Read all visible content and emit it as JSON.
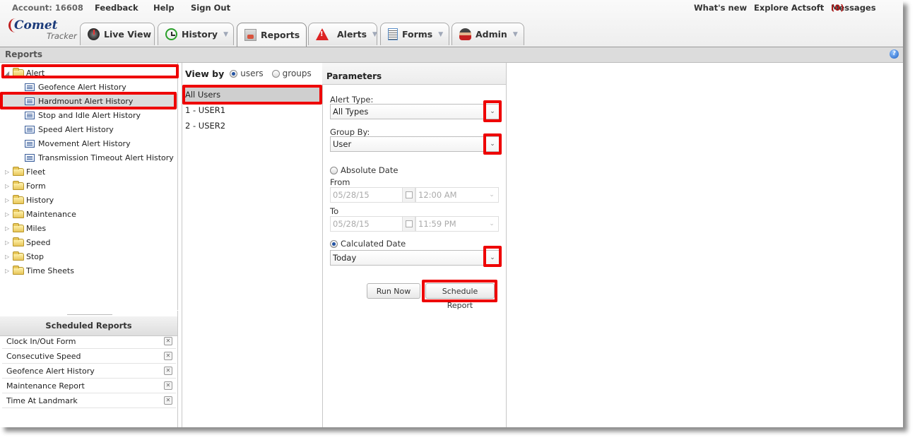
{
  "top_links": {
    "account": "Account: 16608",
    "feedback": "Feedback",
    "help": "Help",
    "sign_out": "Sign Out",
    "whats_new": "What's new",
    "explore": "Explore Actsoft",
    "messages": "Messages",
    "messages_count": "(0)"
  },
  "logo": {
    "name": "Comet",
    "sub": "Tracker"
  },
  "tabs": [
    {
      "label": "Live View",
      "icon": "live-view-icon",
      "has_dropdown": false
    },
    {
      "label": "History",
      "icon": "clock-icon",
      "has_dropdown": true
    },
    {
      "label": "Reports",
      "icon": "reports-icon",
      "has_dropdown": false,
      "active": true
    },
    {
      "label": "Alerts",
      "icon": "alert-triangle-icon",
      "has_dropdown": true
    },
    {
      "label": "Forms",
      "icon": "document-icon",
      "has_dropdown": true
    },
    {
      "label": "Admin",
      "icon": "admin-user-icon",
      "has_dropdown": true
    }
  ],
  "dropdown_glyph": "▼",
  "reports_header": {
    "title": "Reports",
    "help_glyph": "?"
  },
  "tree": {
    "alert_folder": "Alert",
    "alert_children": [
      "Geofence Alert History",
      "Hardmount Alert History",
      "Stop and Idle Alert History",
      "Speed Alert History",
      "Movement Alert History",
      "Transmission Timeout Alert History"
    ],
    "selected_child": "Hardmount Alert History",
    "folders": [
      "Fleet",
      "Form",
      "History",
      "Maintenance",
      "Miles",
      "Speed",
      "Stop",
      "Time Sheets"
    ],
    "expanded_glyph": "◢",
    "collapsed_glyph": "▷"
  },
  "scheduled": {
    "title": "Scheduled Reports",
    "items": [
      "Clock In/Out Form",
      "Consecutive Speed",
      "Geofence Alert History",
      "Maintenance Report",
      "Time At Landmark"
    ],
    "remove_glyph": "✕"
  },
  "users_panel": {
    "view_by_label": "View by",
    "option_users": "users",
    "option_groups": "groups",
    "selected_option": "users",
    "rows": [
      "All Users",
      "1 - USER1",
      "2 - USER2"
    ],
    "selected_row": "All Users"
  },
  "params": {
    "title": "Parameters",
    "alert_type_label": "Alert Type:",
    "alert_type_value": "All Types",
    "group_by_label": "Group By:",
    "group_by_value": "User",
    "absolute_date_label": "Absolute Date",
    "from_label": "From",
    "from_date": "05/28/15",
    "from_time": "12:00 AM",
    "to_label": "To",
    "to_date": "05/28/15",
    "to_time": "11:59 PM",
    "calculated_date_label": "Calculated Date",
    "calculated_date_value": "Today",
    "date_mode": "calculated",
    "run_now": "Run Now",
    "schedule_report": "Schedule Report",
    "caret_glyph": "⌄"
  },
  "highlight_color": "#ee0000"
}
